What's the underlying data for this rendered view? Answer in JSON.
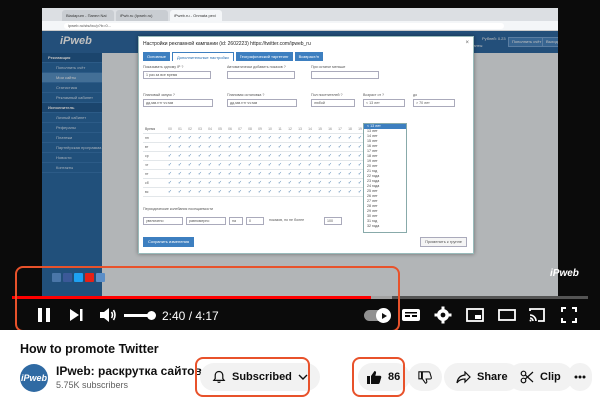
{
  "browser": {
    "tabs": [
      "Biadapum - Пaнeл Nai",
      "iPwb.ru (Ipweb.ru)",
      "iPweb.ru - Onmata pexi"
    ],
    "url": "ipweb.ru/sts/ixc/p?b=0..."
  },
  "site": {
    "logo": "iPweb",
    "header_user": "imagination",
    "header_status": "Статус: таланты",
    "header_balance": "Рублей: 0.23",
    "header_btn_1": "Пополнить счёт",
    "header_btn_2": "Выход",
    "sidebar": [
      {
        "label": "Рекламщик",
        "type": "head"
      },
      {
        "label": "Пополнить счёт",
        "type": "item"
      },
      {
        "label": "Мои сайты",
        "type": "active"
      },
      {
        "label": "Статистика",
        "type": "item"
      },
      {
        "label": "Рекламный кабинет",
        "type": "item"
      },
      {
        "label": "Исполнитель",
        "type": "head"
      },
      {
        "label": "Личный кабинет",
        "type": "item"
      },
      {
        "label": "Рефералы",
        "type": "item"
      },
      {
        "label": "Платежи",
        "type": "item"
      },
      {
        "label": "Партнёрская программа",
        "type": "item"
      },
      {
        "label": "Новости",
        "type": "item"
      },
      {
        "label": "Контакты",
        "type": "item"
      }
    ]
  },
  "modal": {
    "title": "Настройки рекламной кампании (id: 2602223) https://twitter.com/ipweb_ru",
    "close": "×",
    "tabs": [
      "Основные",
      "Дополнительные настройки",
      "Географический таргетинг",
      "Возвраст/п"
    ],
    "fields": [
      {
        "label": "Показывать одному IP ?",
        "value": "1 раз за все время"
      },
      {
        "label": "Автоматически добавить показов ?",
        "value": ""
      },
      {
        "label": "При остатке меньше",
        "value": ""
      },
      {
        "label": "Плановый запуск ?",
        "value": "дд.мм.гггг чч:мм"
      },
      {
        "label": "Плановая остановка ?",
        "value": "дд.мм.гггг чч:мм"
      },
      {
        "label": "Пол посетителей ?",
        "value": "любой"
      },
      {
        "label": "Возраст от ?",
        "value": "< 13 лет"
      },
      {
        "label": "до",
        "value": "> 70 лет"
      }
    ],
    "grid_header": [
      "Время",
      "00",
      "01",
      "02",
      "03",
      "04",
      "05",
      "06",
      "07",
      "08",
      "09",
      "10",
      "11",
      "12",
      "13",
      "14",
      "15",
      "16",
      "17",
      "18",
      "19",
      "20",
      "21",
      "22",
      "23"
    ],
    "grid_days": [
      "пн",
      "вт",
      "ср",
      "чт",
      "пт",
      "сб",
      "вс"
    ],
    "age_options": [
      "< 13 лет",
      "13 лет",
      "14 лет",
      "15 лет",
      "16 лет",
      "17 лет",
      "18 лет",
      "19 лет",
      "20 лет",
      "21 год",
      "22 года",
      "23 года",
      "24 года",
      "25 лет",
      "26 лет",
      "27 лет",
      "28 лет",
      "29 лет",
      "30 лет",
      "31 год",
      "32 года"
    ],
    "freq_label": "Периодические колебания посещаемости",
    "freq_fields": [
      "увеличено",
      "равномерно",
      "на",
      "0",
      "показов, но не более",
      "100"
    ],
    "save_label": "Сохранить изменения",
    "apply_label": "Применить к группе"
  },
  "watermark": "iPweb",
  "player": {
    "time": "2:40 / 4:17",
    "progress": 0.623,
    "loaded": 0.66,
    "volume": 0.9,
    "autoplay_on": true,
    "accent": "#ff0000",
    "highlight": "#e8522b"
  },
  "video": {
    "title": "How to promote Twitter",
    "channel": "IPweb: раскрутка сайтов...",
    "avatar_text": "iPweb",
    "subscribers": "5.75K subscribers",
    "subscribe_label": "Subscribed",
    "likes": "86",
    "share_label": "Share",
    "clip_label": "Clip"
  }
}
